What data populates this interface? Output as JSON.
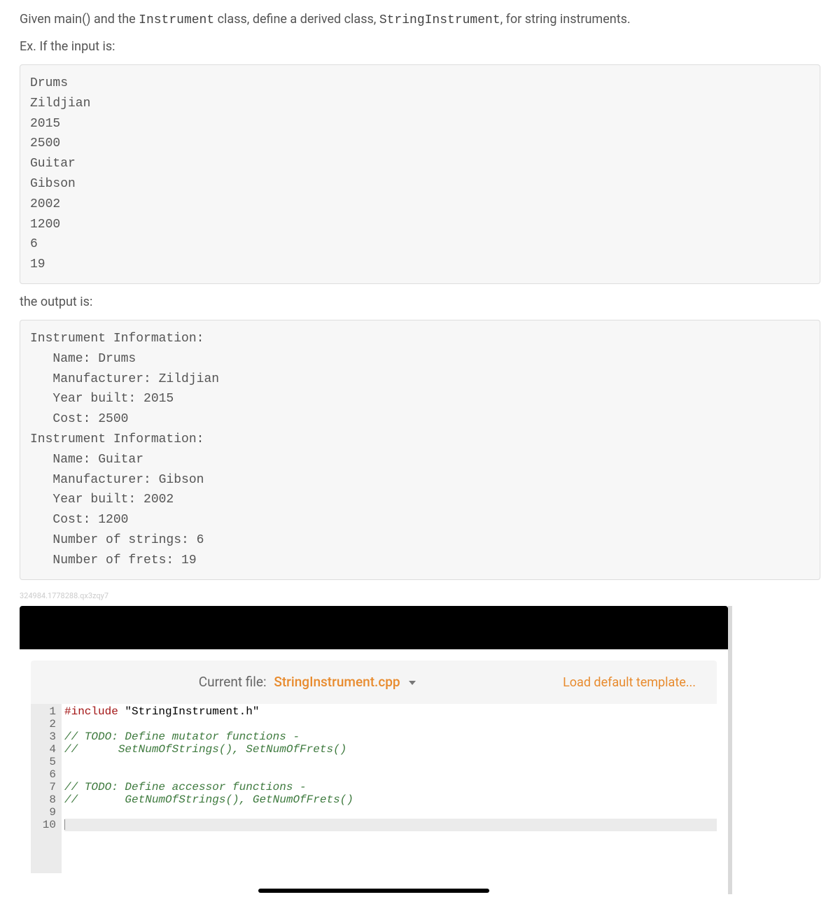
{
  "prompt": {
    "part1": "Given main() and the ",
    "code1": "Instrument",
    "part2": " class, define a derived class, ",
    "code2": "StringInstrument",
    "part3": ", for string instruments."
  },
  "ex_label": "Ex. If the input is:",
  "input_block": "Drums\nZildjian\n2015\n2500\nGuitar\nGibson\n2002\n1200\n6\n19",
  "output_label": "the output is:",
  "output_block": "Instrument Information: \n   Name: Drums\n   Manufacturer: Zildjian\n   Year built: 2015\n   Cost: 2500\nInstrument Information: \n   Name: Guitar\n   Manufacturer: Gibson\n   Year built: 2002\n   Cost: 1200\n   Number of strings: 6\n   Number of frets: 19",
  "footer_id": "324984.1778288.qx3zqy7",
  "filebar": {
    "label": "Current file:",
    "filename": "StringInstrument.cpp",
    "load_template": "Load default template..."
  },
  "code": {
    "lines": [
      {
        "n": "1",
        "pre": "#include",
        "rest": " \"StringInstrument.h\""
      },
      {
        "n": "2",
        "rest": ""
      },
      {
        "n": "3",
        "com": "// TODO: Define mutator functions -"
      },
      {
        "n": "4",
        "com": "//      SetNumOfStrings(), SetNumOfFrets()"
      },
      {
        "n": "5",
        "rest": ""
      },
      {
        "n": "6",
        "rest": ""
      },
      {
        "n": "7",
        "com": "// TODO: Define accessor functions -"
      },
      {
        "n": "8",
        "com": "//       GetNumOfStrings(), GetNumOfFrets()"
      },
      {
        "n": "9",
        "rest": ""
      },
      {
        "n": "10",
        "rest": "",
        "active": true
      }
    ]
  }
}
